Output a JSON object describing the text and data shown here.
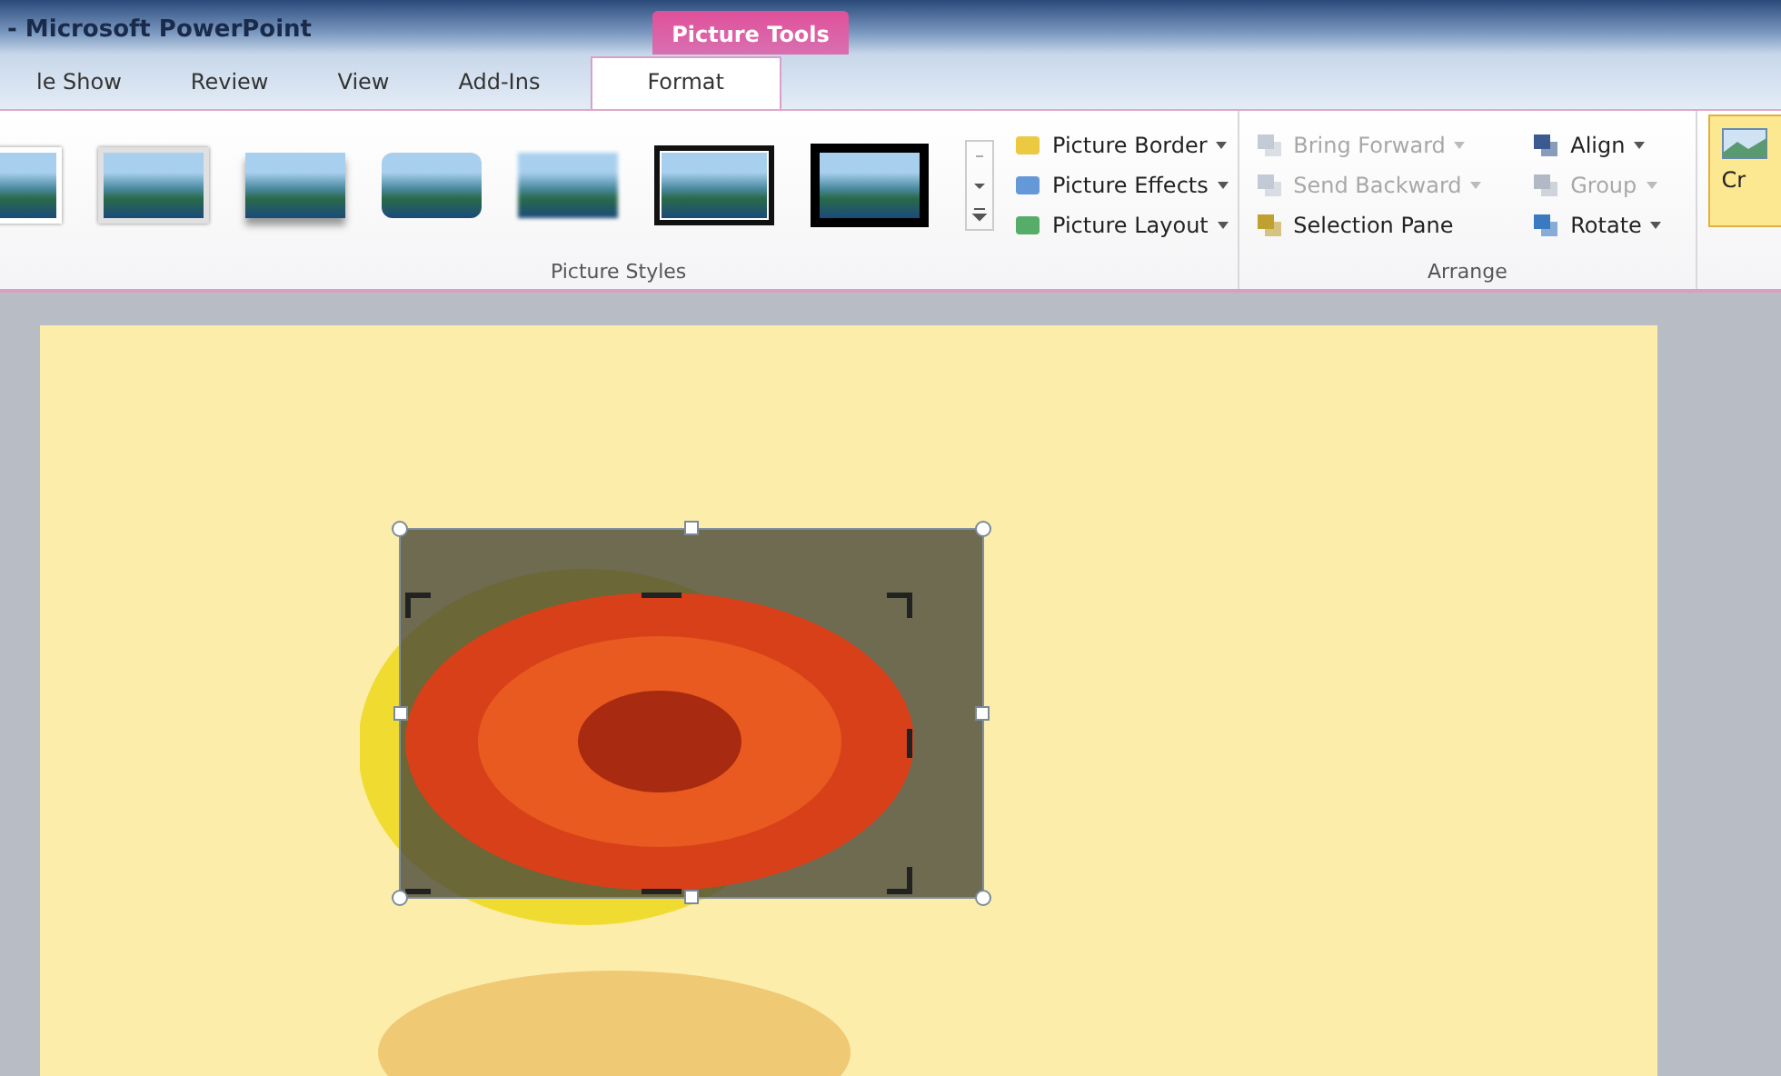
{
  "window": {
    "title": "- Microsoft PowerPoint",
    "context_tab": "Picture Tools"
  },
  "tabs": [
    {
      "label": "le Show",
      "selected": false
    },
    {
      "label": "Review",
      "selected": false
    },
    {
      "label": "View",
      "selected": false
    },
    {
      "label": "Add-Ins",
      "selected": false
    },
    {
      "label": "Format",
      "selected": true
    }
  ],
  "picture_styles": {
    "label": "Picture Styles",
    "thumbnails": [
      {
        "kind": "white-frame"
      },
      {
        "kind": "grey-frame"
      },
      {
        "kind": "shadow"
      },
      {
        "kind": "rounded"
      },
      {
        "kind": "soft-edge"
      },
      {
        "kind": "black-double"
      },
      {
        "kind": "black-thick"
      }
    ],
    "commands": [
      {
        "label": "Picture Border",
        "dropdown": true,
        "disabled": false
      },
      {
        "label": "Picture Effects",
        "dropdown": true,
        "disabled": false
      },
      {
        "label": "Picture Layout",
        "dropdown": true,
        "disabled": false
      }
    ]
  },
  "arrange": {
    "label": "Arrange",
    "commands": [
      {
        "label": "Bring Forward",
        "dropdown": true,
        "disabled": true
      },
      {
        "label": "Align",
        "dropdown": true,
        "disabled": false
      },
      {
        "label": "Send Backward",
        "dropdown": true,
        "disabled": true
      },
      {
        "label": "Group",
        "dropdown": true,
        "disabled": true
      },
      {
        "label": "Selection Pane",
        "dropdown": false,
        "disabled": false
      },
      {
        "label": "Rotate",
        "dropdown": true,
        "disabled": false
      }
    ]
  },
  "crop_button": {
    "label": "Cr"
  }
}
